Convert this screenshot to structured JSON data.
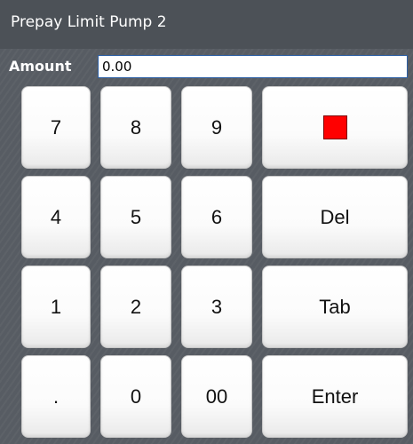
{
  "window": {
    "title": "Prepay Limit Pump 2"
  },
  "amount": {
    "label": "Amount",
    "value": "0.00"
  },
  "keypad": {
    "k7": "7",
    "k8": "8",
    "k9": "9",
    "k4": "4",
    "k5": "5",
    "k6": "6",
    "k1": "1",
    "k2": "2",
    "k3": "3",
    "kdot": ".",
    "k0": "0",
    "k00": "00",
    "del": "Del",
    "tab": "Tab",
    "enter": "Enter",
    "stop_icon": "red-square-icon",
    "stop_color": "#ff0000"
  },
  "colors": {
    "background": "#575c63",
    "title_bar": "#4c5157",
    "input_border": "#2c5fa5"
  }
}
